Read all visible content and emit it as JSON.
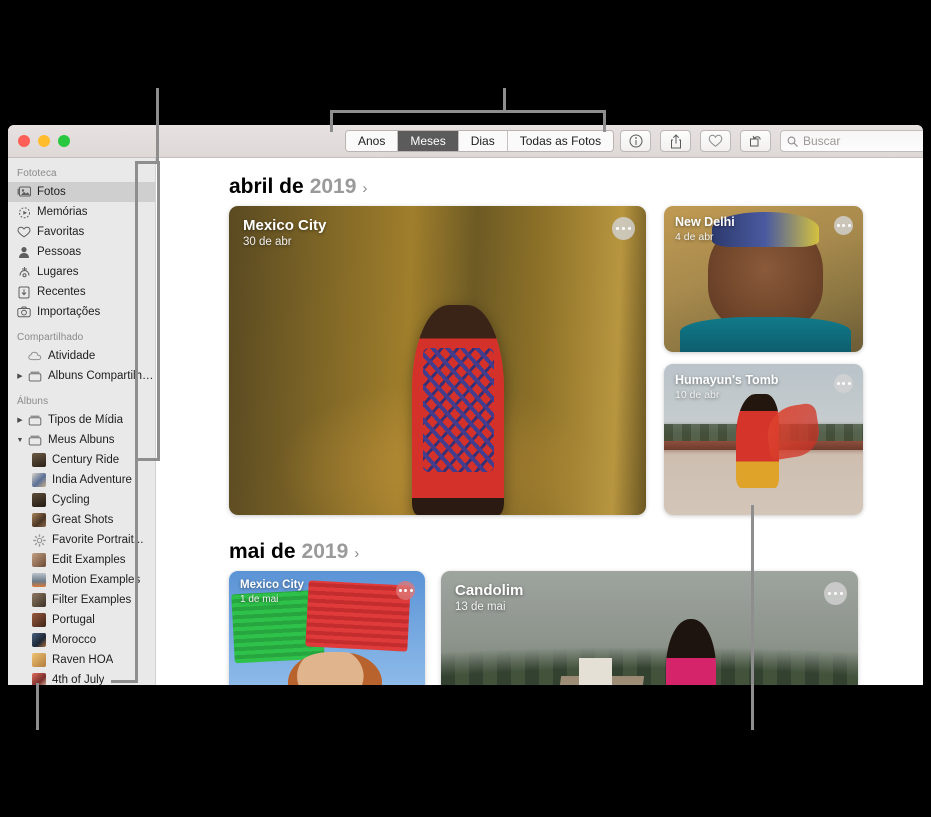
{
  "app": {
    "title": "Fotos"
  },
  "window_controls": {
    "close": "close",
    "minimize": "minimize",
    "zoom": "zoom"
  },
  "toolbar": {
    "segments": [
      {
        "label": "Anos",
        "active": false
      },
      {
        "label": "Meses",
        "active": true
      },
      {
        "label": "Dias",
        "active": false
      },
      {
        "label": "Todas as Fotos",
        "active": false
      }
    ],
    "buttons": [
      {
        "name": "info-icon",
        "label": "Informações"
      },
      {
        "name": "share-icon",
        "label": "Compartilhar"
      },
      {
        "name": "heart-icon",
        "label": "Favorita"
      },
      {
        "name": "rotate-icon",
        "label": "Girar"
      }
    ],
    "search": {
      "placeholder": "Buscar",
      "value": "",
      "icon": "search-icon"
    }
  },
  "sidebar": {
    "sections": [
      {
        "header": "Fototeca",
        "items": [
          {
            "label": "Fotos",
            "icon": "photos-icon",
            "selected": true
          },
          {
            "label": "Memórias",
            "icon": "memories-icon",
            "selected": false
          },
          {
            "label": "Favoritas",
            "icon": "heart-icon",
            "selected": false
          },
          {
            "label": "Pessoas",
            "icon": "person-icon",
            "selected": false
          },
          {
            "label": "Lugares",
            "icon": "map-pin-icon",
            "selected": false
          },
          {
            "label": "Recentes",
            "icon": "download-icon",
            "selected": false
          },
          {
            "label": "Importações",
            "icon": "camera-icon",
            "selected": false
          }
        ]
      },
      {
        "header": "Compartilhado",
        "items": [
          {
            "label": "Atividade",
            "icon": "cloud-icon",
            "selected": false,
            "indent": true
          },
          {
            "label": "Álbuns Compartilhados",
            "icon": "album-icon",
            "selected": false,
            "disclosure": "collapsed"
          }
        ]
      },
      {
        "header": "Álbuns",
        "items": [
          {
            "label": "Tipos de Mídia",
            "icon": "album-icon",
            "selected": false,
            "disclosure": "collapsed"
          },
          {
            "label": "Meus Álbuns",
            "icon": "album-icon",
            "selected": false,
            "disclosure": "expanded"
          },
          {
            "label": "Century Ride",
            "icon": "album-thumb",
            "selected": false,
            "sub": true,
            "thumb": "#4a3c30"
          },
          {
            "label": "India Adventure",
            "icon": "album-thumb",
            "selected": false,
            "sub": true,
            "thumb": "#6f7fa0"
          },
          {
            "label": "Cycling",
            "icon": "album-thumb",
            "selected": false,
            "sub": true,
            "thumb": "#3e3227"
          },
          {
            "label": "Great Shots",
            "icon": "album-thumb",
            "selected": false,
            "sub": true,
            "thumb": "#7b5a3e"
          },
          {
            "label": "Favorite Portrait...",
            "icon": "gear-icon",
            "selected": false,
            "sub": true
          },
          {
            "label": "Edit Examples",
            "icon": "album-thumb",
            "selected": false,
            "sub": true,
            "thumb": "#8f6f57"
          },
          {
            "label": "Motion Examples",
            "icon": "album-thumb",
            "selected": false,
            "sub": true,
            "thumb": "#9aa3ad"
          },
          {
            "label": "Filter Examples",
            "icon": "album-thumb",
            "selected": false,
            "sub": true,
            "thumb": "#6a5b4a"
          },
          {
            "label": "Portugal",
            "icon": "album-thumb",
            "selected": false,
            "sub": true,
            "thumb": "#7a4a38"
          },
          {
            "label": "Morocco",
            "icon": "album-thumb",
            "selected": false,
            "sub": true,
            "thumb": "#3b4c66"
          },
          {
            "label": "Raven HOA",
            "icon": "album-thumb",
            "selected": false,
            "sub": true,
            "thumb": "#d8a24f"
          },
          {
            "label": "4th of July",
            "icon": "album-thumb",
            "selected": false,
            "sub": true,
            "thumb": "#c0504c"
          }
        ]
      }
    ]
  },
  "content": {
    "groups": [
      {
        "month": "abril de",
        "year": "2019",
        "chevron": "›",
        "cards": [
          {
            "title": "Mexico City",
            "date": "30 de abr",
            "menu": "more-options"
          },
          {
            "title": "New Delhi",
            "date": "4 de abr",
            "menu": "more-options"
          },
          {
            "title": "Humayun's Tomb",
            "date": "10 de abr",
            "menu": "more-options"
          }
        ]
      },
      {
        "month": "mai de",
        "year": "2019",
        "chevron": "›",
        "cards": [
          {
            "title": "Mexico City",
            "date": "1 de mai",
            "menu": "more-options"
          },
          {
            "title": "Candolim",
            "date": "13 de mai",
            "menu": "more-options"
          }
        ]
      }
    ]
  }
}
